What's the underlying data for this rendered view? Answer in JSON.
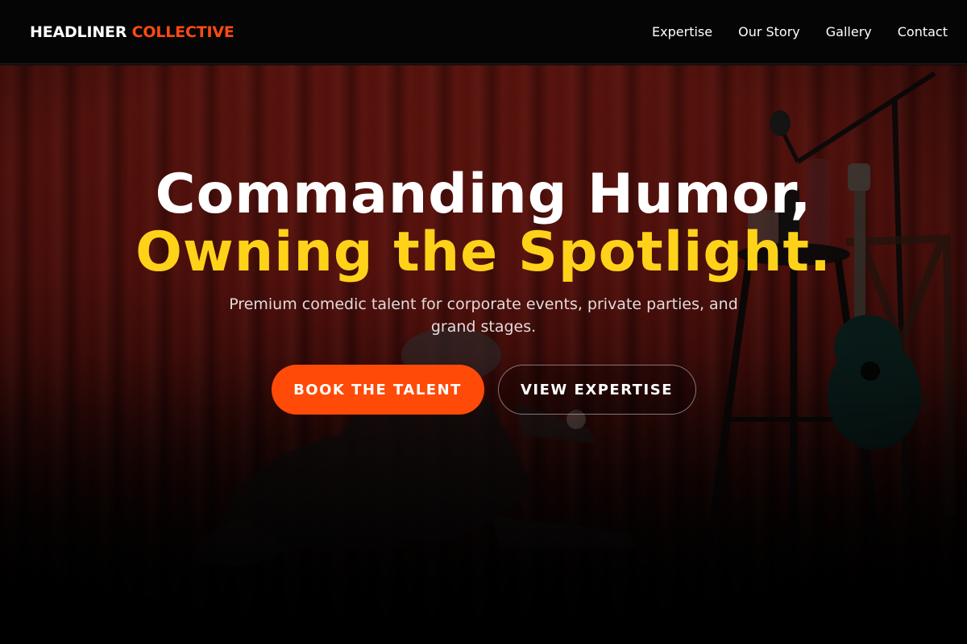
{
  "header": {
    "brand_first": "HEADLINER",
    "brand_second": "COLLECTIVE",
    "nav": [
      {
        "label": "Expertise"
      },
      {
        "label": "Our Story"
      },
      {
        "label": "Gallery"
      },
      {
        "label": "Contact"
      }
    ]
  },
  "hero": {
    "headline_line1": "Commanding Humor,",
    "headline_line2": "Owning the Spotlight.",
    "subtitle": "Premium comedic talent for corporate events, private parties, and grand stages.",
    "primary_cta": "BOOK THE TALENT",
    "secondary_cta": "VIEW EXPERTISE",
    "background_image": "comedian on stage with microphone stand, guitar and stool in front of red curtain"
  },
  "colors": {
    "accent": "#ff4a12",
    "highlight": "#ffd21a",
    "background": "#000000",
    "curtain": "#7a1711"
  }
}
